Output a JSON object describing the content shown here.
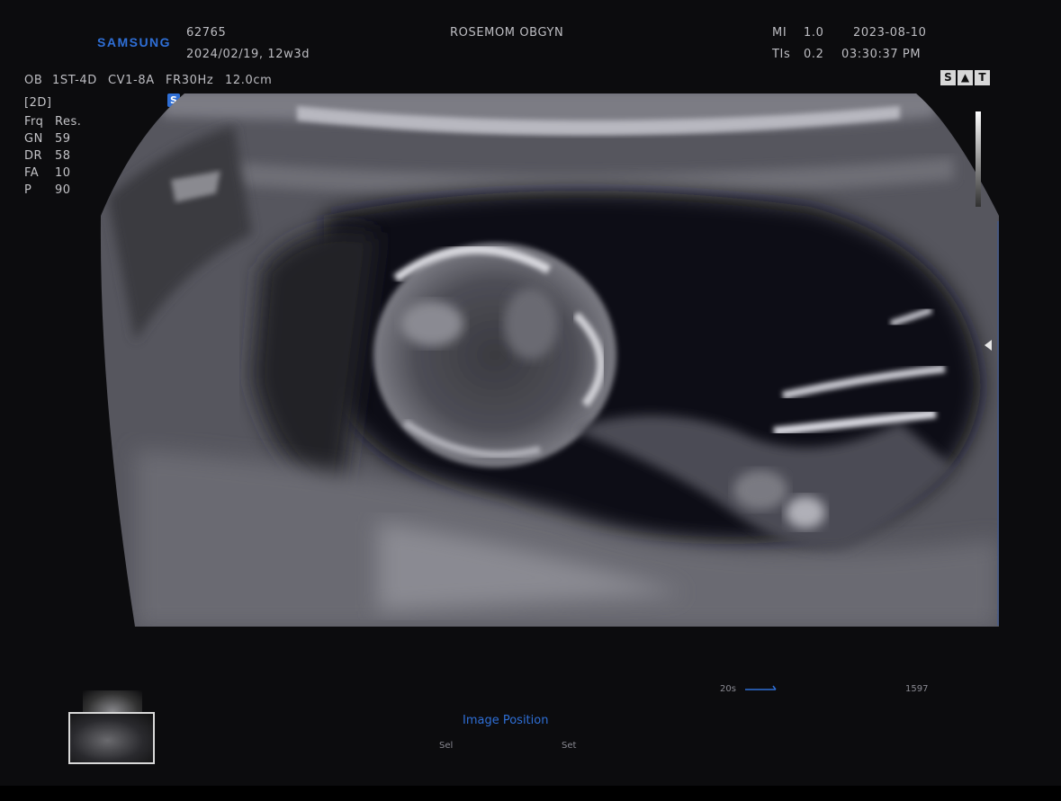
{
  "header": {
    "brand": "SAMSUNG",
    "patient_id": "62765",
    "lmp_ga": "2024/02/19, 12w3d",
    "institution": "ROSEMOM OBGYN",
    "mi_label": "MI",
    "mi_value": "1.0",
    "tis_label": "TIs",
    "tis_value": "0.2",
    "date": "2023-08-10",
    "time": "03:30:37 PM"
  },
  "probe_line": {
    "preset": "OB",
    "exam": "1ST-4D",
    "probe": "CV1-8A",
    "frame_rate": "FR30Hz",
    "depth": "12.0cm"
  },
  "params": {
    "mode": "[2D]",
    "items": [
      {
        "k": "Frq",
        "v": "Res."
      },
      {
        "k": "GN",
        "v": "59"
      },
      {
        "k": "DR",
        "v": "58"
      },
      {
        "k": "FA",
        "v": "10"
      },
      {
        "k": "P",
        "v": "90"
      }
    ]
  },
  "badges": {
    "s_badge": "S",
    "icons": [
      "S",
      "▲",
      "T"
    ]
  },
  "bottom": {
    "image_position": "Image Position",
    "left_hint": "Sel",
    "right_hint": "Set",
    "cine_time": "20s",
    "frame_counter": "1597"
  }
}
